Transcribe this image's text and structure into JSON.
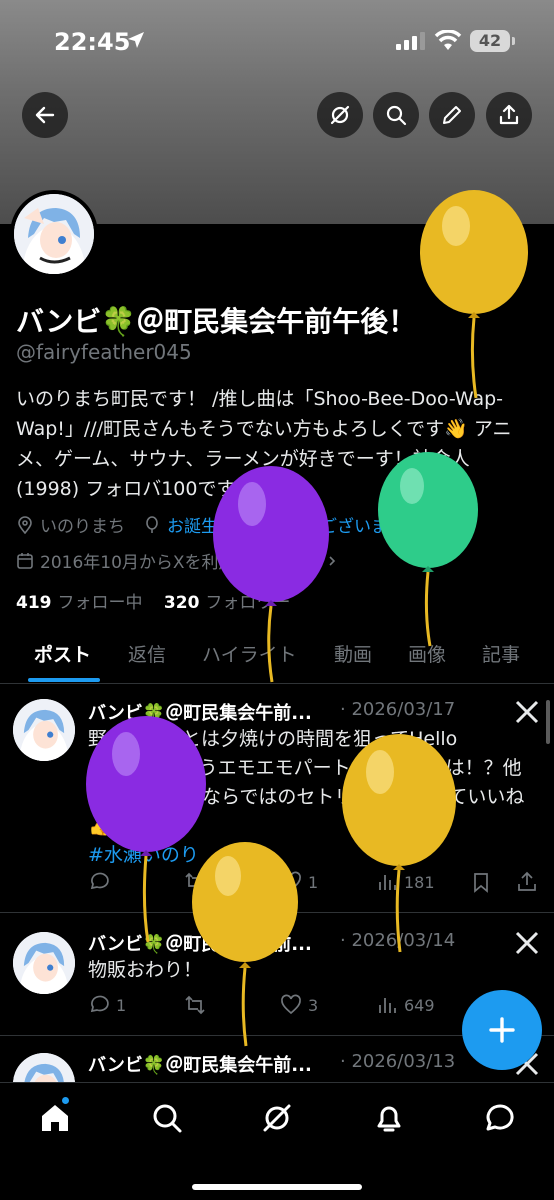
{
  "status_bar": {
    "time": "22:45",
    "battery": "42"
  },
  "profile": {
    "display_name": "バンビ🍀＠町民集会午前午後！",
    "handle": "@fairyfeather045",
    "bio": "いのりまち町民です！ /推し曲は「Shoo-Bee-Doo-Wap-Wap!」///町民さんもそうでない方もよろしくです👋 アニメ、ゲーム、サウナ、ラーメンが好きでーす！社会人 (1998) フォロバ100です！",
    "location": "いのりまち",
    "birthday": "お誕生日おめでとうございます。",
    "joined": "2016年10月からXを利用しています",
    "following_count": "419",
    "following_label": "フォロー中",
    "followers_count": "320",
    "followers_label": "フォロワー"
  },
  "tabs": [
    {
      "label": "ポスト"
    },
    {
      "label": "返信"
    },
    {
      "label": "ハイライト"
    },
    {
      "label": "動画"
    },
    {
      "label": "画像"
    },
    {
      "label": "記事"
    }
  ],
  "posts": [
    {
      "author": "バンビ🍀＠町民集会午前...",
      "date": "· 2026/03/17",
      "text": "野外ってことは夕焼けの時間を狙ってHello Horizonを歌うエモエモパートが来るのでは！？他にも天気や外ならではのセトリ予想ができていいね👍",
      "hashtag": "#水瀬いのり",
      "replies": "",
      "reposts": "",
      "likes": "1",
      "views": "181"
    },
    {
      "author": "バンビ🍀＠町民集会午前...",
      "date": "· 2026/03/14",
      "text": "物販おわり！",
      "replies": "1",
      "reposts": "",
      "likes": "3",
      "views": "649"
    },
    {
      "author": "バンビ🍀＠町民集会午前...",
      "date": "· 2026/03/13"
    }
  ],
  "colors": {
    "accent": "#1d9bf0",
    "balloon_yellow": "#e8b923",
    "balloon_purple": "#8a2be2",
    "balloon_green": "#2ecc8a"
  }
}
